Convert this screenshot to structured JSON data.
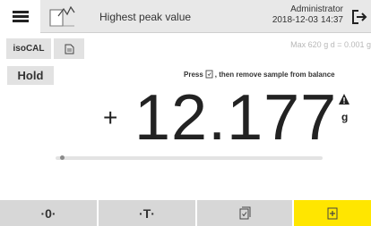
{
  "header": {
    "menu_icon": "hamburger-menu-icon",
    "app_icon": "peak-value-document-icon",
    "title": "Highest peak value",
    "user": "Administrator",
    "date": "2018-12-03",
    "time": "14:37",
    "logout_icon": "logout-icon"
  },
  "toolbar": {
    "isocal_label": "isoCAL",
    "doc_icon": "document-icon"
  },
  "balance_info": "Max 620 g  d = 0.001 g",
  "hold_label": "Hold",
  "instruction": {
    "before": "Press",
    "icon": "print-document-icon",
    "after": ", then remove sample from balance"
  },
  "reading": {
    "sign": "+",
    "value": "12.177",
    "unit": "g",
    "warning_icon": "warning-triangle-icon"
  },
  "progress": {
    "value": 0.01
  },
  "bottom": {
    "zero_label": "·0·",
    "tare_label": "·T·",
    "print_icon": "print-check-icon",
    "add_icon": "add-document-icon"
  },
  "colors": {
    "accent": "#ffe600",
    "button_bg": "#d7d7d7",
    "chip_bg": "#e2e2e2",
    "topbar_bg": "#e8e8e8"
  }
}
